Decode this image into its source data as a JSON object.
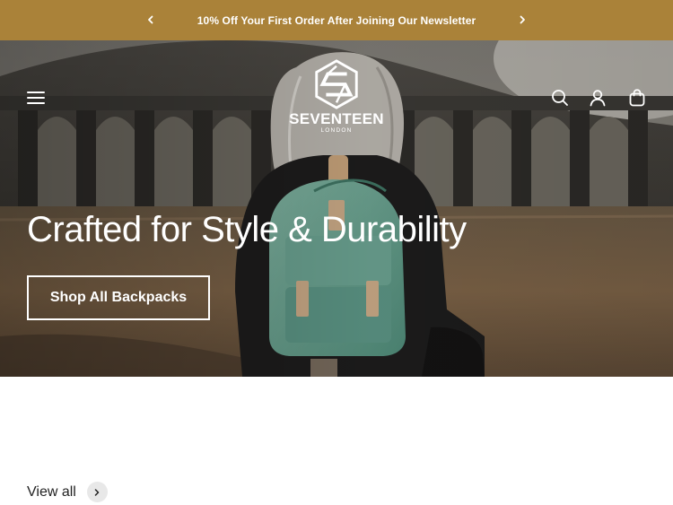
{
  "colors": {
    "brand": "#aa8239",
    "hero_text": "#ffffff",
    "pill_bg": "#e8e8e8"
  },
  "announcement": {
    "message": "10% Off Your First Order After Joining Our Newsletter",
    "prev_icon": "chevron-left-icon",
    "next_icon": "chevron-right-icon"
  },
  "header": {
    "menu_icon": "hamburger-menu-icon",
    "logo": {
      "word": "SEVENTEEN",
      "subword": "LONDON"
    },
    "icons": [
      "search-icon",
      "account-icon",
      "cart-icon"
    ]
  },
  "hero": {
    "headline": "Crafted for Style & Durability",
    "cta_label": "Shop All Backpacks"
  },
  "collection": {
    "view_all_label": "View all",
    "view_all_icon": "chevron-right-icon"
  }
}
